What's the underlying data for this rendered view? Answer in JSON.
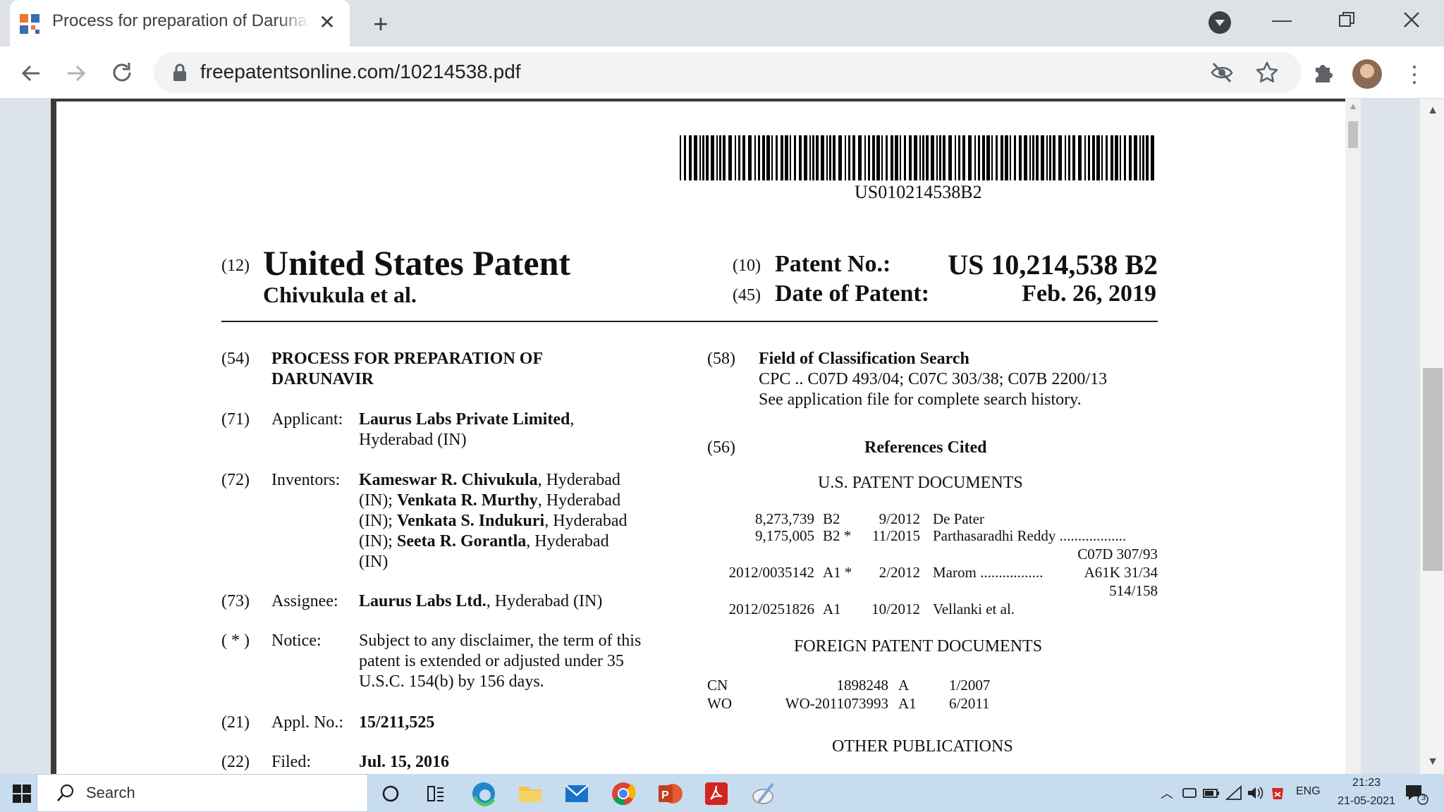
{
  "browser": {
    "tab_title": "Process for preparation of Darunavir",
    "url": "freepatentsonline.com/10214538.pdf"
  },
  "patent": {
    "barcode_number": "US010214538B2",
    "code_12": "(12)",
    "title": "United States Patent",
    "authors": "Chivukula et al.",
    "code_10": "(10)",
    "patent_no_label": "Patent No.:",
    "patent_no": "US 10,214,538 B2",
    "code_45": "(45)",
    "date_label": "Date of Patent:",
    "date": "Feb. 26, 2019",
    "f54": {
      "code": "(54)",
      "line1": "PROCESS FOR PREPARATION OF",
      "line2": "DARUNAVIR"
    },
    "f71": {
      "code": "(71)",
      "label": "Applicant:",
      "name": "Laurus Labs Private Limited",
      "suffix": ",",
      "line2": "Hyderabad (IN)"
    },
    "f72": {
      "code": "(72)",
      "label": "Inventors:",
      "inv1": "Kameswar R. Chivukula",
      "loc1": ", Hyderabad",
      "pre2": "(IN); ",
      "inv2": "Venkata R. Murthy",
      "loc2": ", Hyderabad",
      "pre3": "(IN); ",
      "inv3": "Venkata S. Indukuri",
      "loc3": ", Hyderabad",
      "pre4": "(IN); ",
      "inv4": "Seeta R. Gorantla",
      "loc4": ", Hyderabad",
      "end": "(IN)"
    },
    "f73": {
      "code": "(73)",
      "label": "Assignee:",
      "name": "Laurus Labs Ltd.",
      "rest": ", Hyderabad (IN)"
    },
    "notice": {
      "code": "( * )",
      "label": "Notice:",
      "line1": "Subject to any disclaimer, the term of this",
      "line2": "patent is extended or adjusted under 35",
      "line3": "U.S.C. 154(b) by 156 days."
    },
    "f21": {
      "code": "(21)",
      "label": "Appl. No.:",
      "value": "15/211,525"
    },
    "f22": {
      "code": "(22)",
      "label": "Filed:",
      "value": "Jul. 15, 2016"
    },
    "f58": {
      "code": "(58)",
      "title": "Field of Classification Search",
      "line1": "CPC .. C07D 493/04; C07C 303/38; C07B 2200/13",
      "line2": "See application file for complete search history."
    },
    "f56": {
      "code": "(56)",
      "title": "References Cited"
    },
    "us_docs_heading": "U.S. PATENT DOCUMENTS",
    "us_docs": [
      {
        "number": "8,273,739",
        "kind": "B2",
        "date": "9/2012",
        "name": "De Pater",
        "cls": "",
        "cls2": ""
      },
      {
        "number": "9,175,005",
        "kind": "B2 *",
        "date": "11/2015",
        "name": "Parthasaradhi Reddy ..................",
        "cls": "",
        "cls2": "C07D 307/93"
      },
      {
        "number": "2012/0035142",
        "kind": "A1 *",
        "date": "2/2012",
        "name": "Marom .................",
        "cls": "A61K 31/34",
        "cls2": "514/158"
      },
      {
        "number": "2012/0251826",
        "kind": "A1",
        "date": "10/2012",
        "name": "Vellanki et al.",
        "cls": "",
        "cls2": ""
      }
    ],
    "foreign_heading": "FOREIGN PATENT DOCUMENTS",
    "foreign_docs": [
      {
        "country": "CN",
        "number": "1898248",
        "kind": "A",
        "date": "1/2007"
      },
      {
        "country": "WO",
        "number": "WO-2011073993",
        "kind": "A1",
        "date": "6/2011"
      }
    ],
    "other_heading": "OTHER PUBLICATIONS"
  },
  "taskbar": {
    "search_placeholder": "Search",
    "lang": "ENG",
    "time": "21:23",
    "date": "21-05-2021",
    "notifications": "3"
  }
}
